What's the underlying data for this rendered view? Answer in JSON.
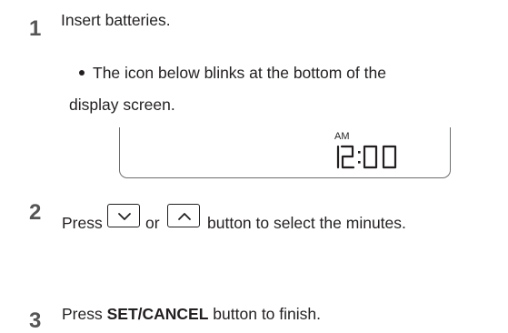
{
  "steps": [
    {
      "number": "1",
      "text": "Insert batteries.",
      "bullet": {
        "line1": "The icon below blinks at the bottom of the",
        "line2": "display screen."
      },
      "display": {
        "am": "AM",
        "time": "12:00"
      }
    },
    {
      "number": "2",
      "text_before": "Press",
      "text_or": "or",
      "text_after": "button to select the minutes.",
      "buttons": [
        {
          "icon": "chevron-down-icon"
        },
        {
          "icon": "chevron-up-icon"
        }
      ]
    },
    {
      "number": "3",
      "text_before": "Press",
      "bold": "SET/CANCEL",
      "text_after": "button to finish."
    }
  ]
}
